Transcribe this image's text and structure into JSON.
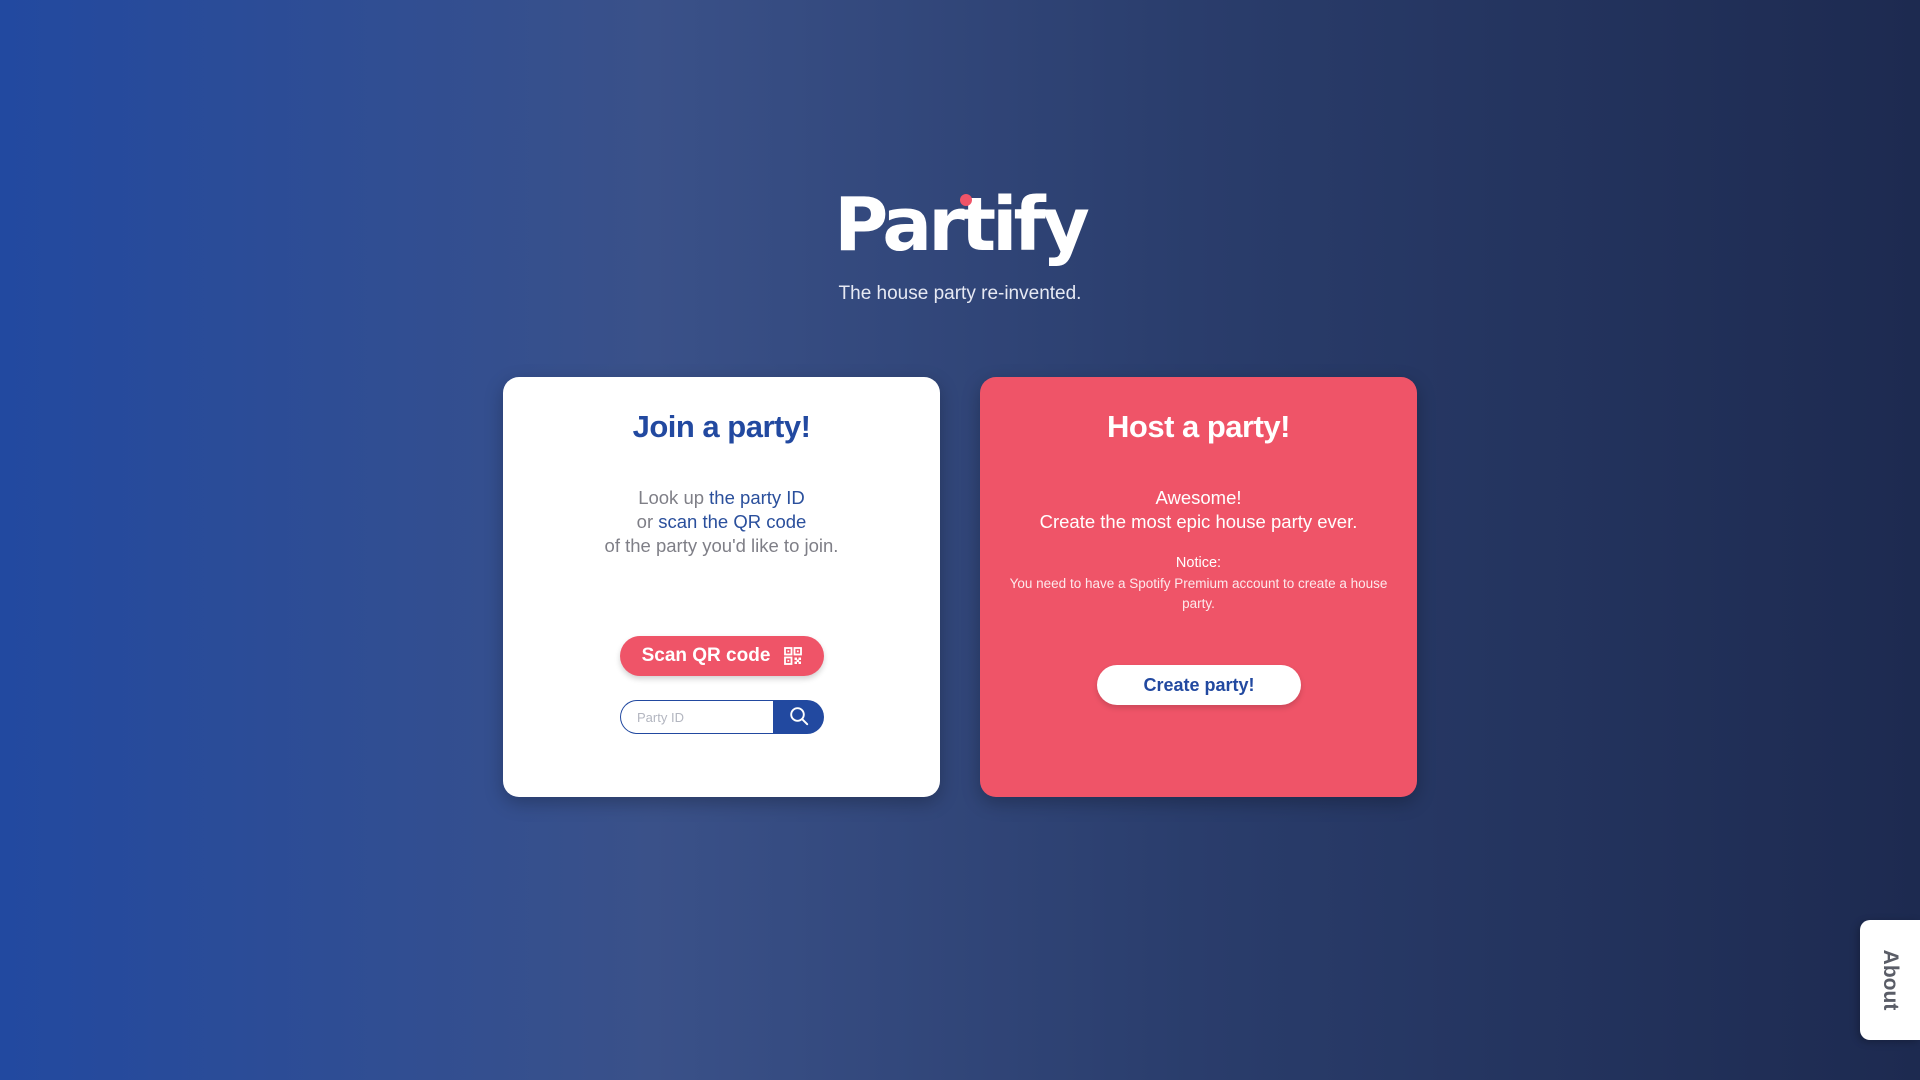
{
  "hero": {
    "logo": "Partify",
    "tagline": "The house party re-invented."
  },
  "join": {
    "title": "Join a party!",
    "desc_line1_prefix": "Look up ",
    "desc_line1_link": "the party ID",
    "desc_line2_prefix": "or ",
    "desc_line2_link": "scan the QR code",
    "desc_line3": "of the party you'd like to join.",
    "scan_button_label": "Scan QR code",
    "party_id_placeholder": "Party ID",
    "party_id_value": ""
  },
  "host": {
    "title": "Host a party!",
    "awesome": "Awesome!",
    "pitch": "Create the most epic house party ever.",
    "notice_label": "Notice:",
    "notice_text": "You need to have a Spotify Premium account to create a house party.",
    "create_button_label": "Create party!"
  },
  "about": {
    "label": "About"
  },
  "icons": {
    "scan_button_icon": "qr-code-icon",
    "search_button_icon": "search-icon"
  },
  "colors": {
    "primary_blue": "#2249a0",
    "accent_red": "#ef5468",
    "white": "#ffffff",
    "muted_text": "#7f7f87"
  }
}
